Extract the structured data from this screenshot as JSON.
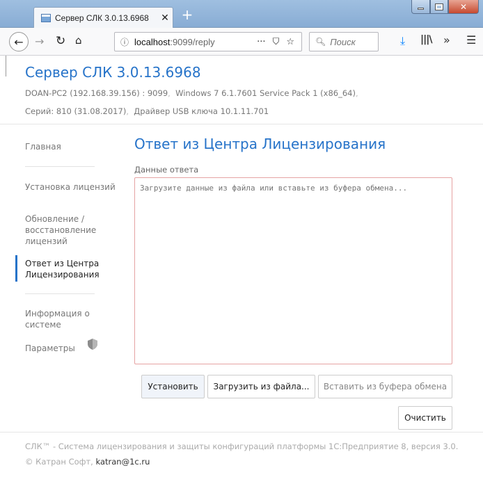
{
  "browser": {
    "tab_title": "Сервер СЛК 3.0.13.6968",
    "tab_close": "✕",
    "new_tab": "+",
    "url_host": "localhost",
    "url_path": ":9099/reply",
    "search_placeholder": "Поиск",
    "icons": {
      "back": "back-arrow-icon",
      "forward": "forward-arrow-icon",
      "reload": "reload-icon",
      "home": "home-icon",
      "info": "info-icon",
      "page_actions": "ellipsis-icon",
      "pocket": "pocket-icon",
      "bookmark": "star-icon",
      "search": "search-icon",
      "downloads": "download-icon",
      "library": "library-icon",
      "overflow": "chevron-double-right-icon",
      "menu": "hamburger-menu-icon"
    }
  },
  "header": {
    "title": "Сервер СЛК 3.0.13.6968",
    "host_info": "DOAN-PC2 (192.168.39.156) : 9099",
    "os_info": "Windows 7 6.1.7601 Service Pack 1 (x86_64)",
    "series_info": "Серий: 810 (31.08.2017)",
    "driver_info": "Драйвер USB ключа 10.1.11.701",
    "separator": ","
  },
  "sidebar": {
    "home": "Главная",
    "install": "Установка лицензий",
    "update": "Обновление / восстановление лицензий",
    "reply": "Ответ из Центра Лицензирования",
    "system_info": "Информация о системе",
    "settings": "Параметры"
  },
  "content": {
    "title": "Ответ из Центра Лицензирования",
    "field_label": "Данные ответа",
    "textarea_placeholder": "Загрузите данные из файла или вставьте из буфера обмена...",
    "buttons": {
      "install": "Установить",
      "load_file": "Загрузить из файла...",
      "paste": "Вставить из буфера обмена",
      "clear": "Очистить"
    }
  },
  "footer": {
    "line1": "СЛК™ - Система лицензирования и защиты конфигураций платформы 1С:Предприятие 8, версия 3.0.",
    "copyright": "© Катран Софт,",
    "email": "katran@1c.ru"
  },
  "colors": {
    "accent": "#2673c9",
    "textarea_border": "#e6a3a3"
  }
}
